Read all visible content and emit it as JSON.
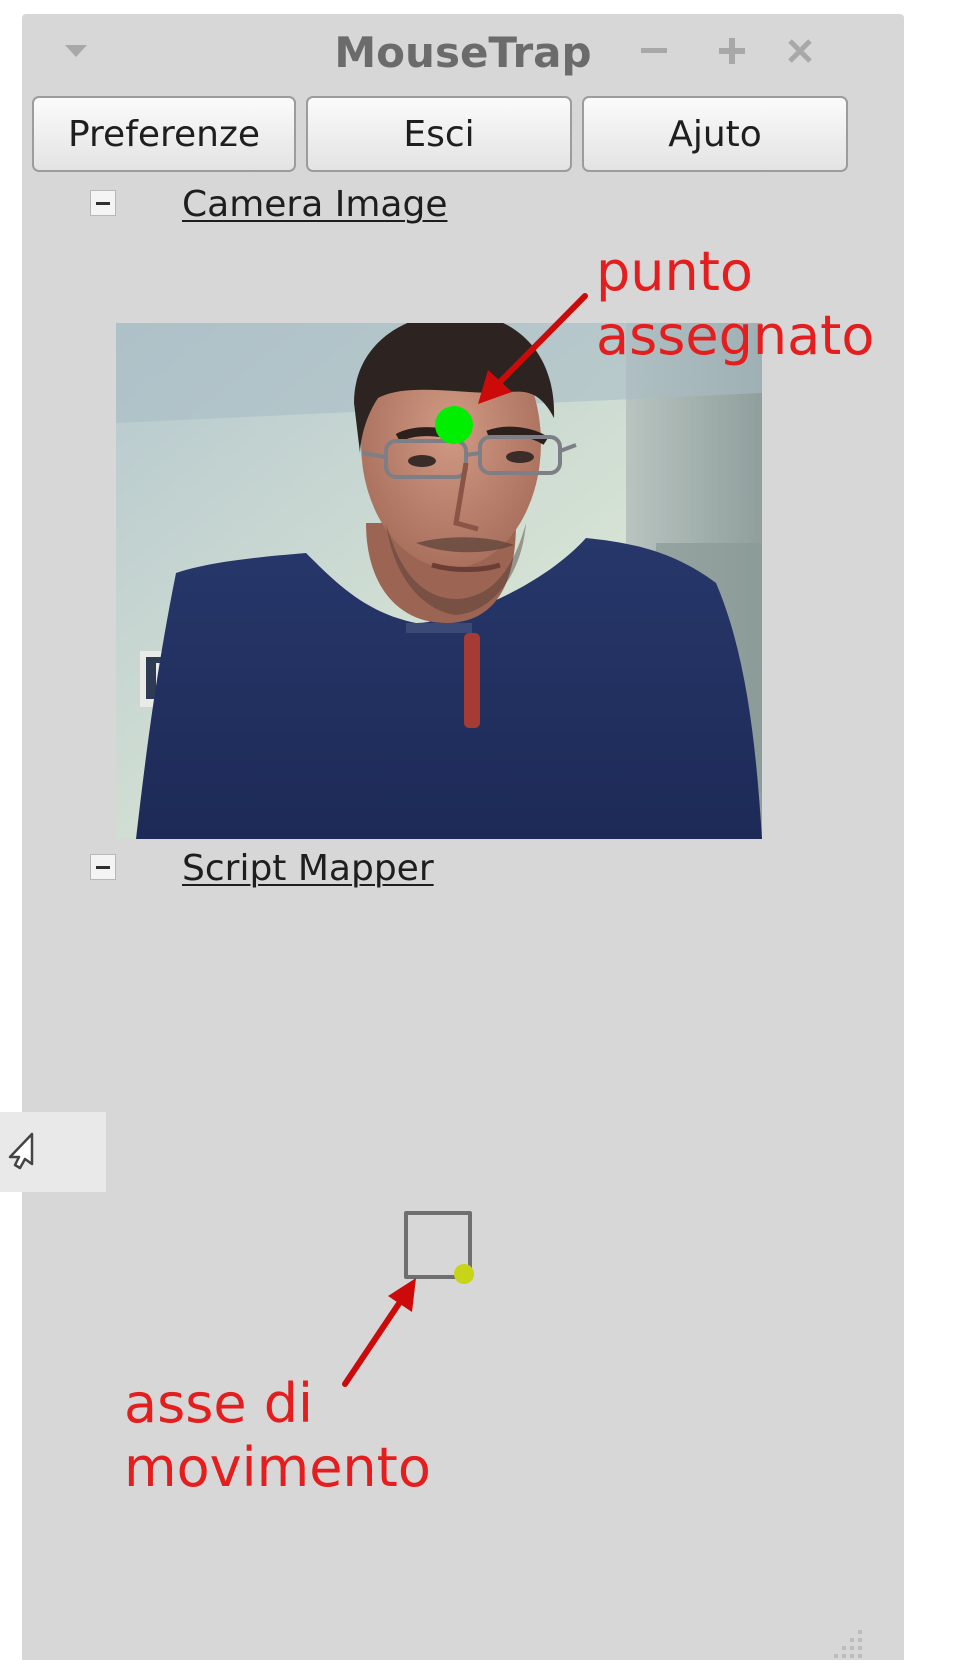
{
  "window": {
    "title": "MouseTrap",
    "menu_icon": "chevron-down-icon",
    "minimize_icon": "minimize-icon",
    "maximize_icon": "plus-icon",
    "close_icon": "close-icon"
  },
  "toolbar": {
    "buttons": [
      {
        "label": "Preferenze"
      },
      {
        "label": "Esci"
      },
      {
        "label": "Ajuto"
      }
    ]
  },
  "sections": {
    "camera": {
      "label": "Camera Image"
    },
    "script_mapper": {
      "label": "Script Mapper"
    }
  },
  "annotations": {
    "top_line1": "punto",
    "top_line2": "assegnato",
    "bottom_line1": "asse di",
    "bottom_line2": "movimento"
  },
  "colors": {
    "window_bg": "#d7d7d7",
    "annotation": "#e41e1e",
    "tracking_point": "#00ee00",
    "axis_dot": "#c7d417"
  }
}
